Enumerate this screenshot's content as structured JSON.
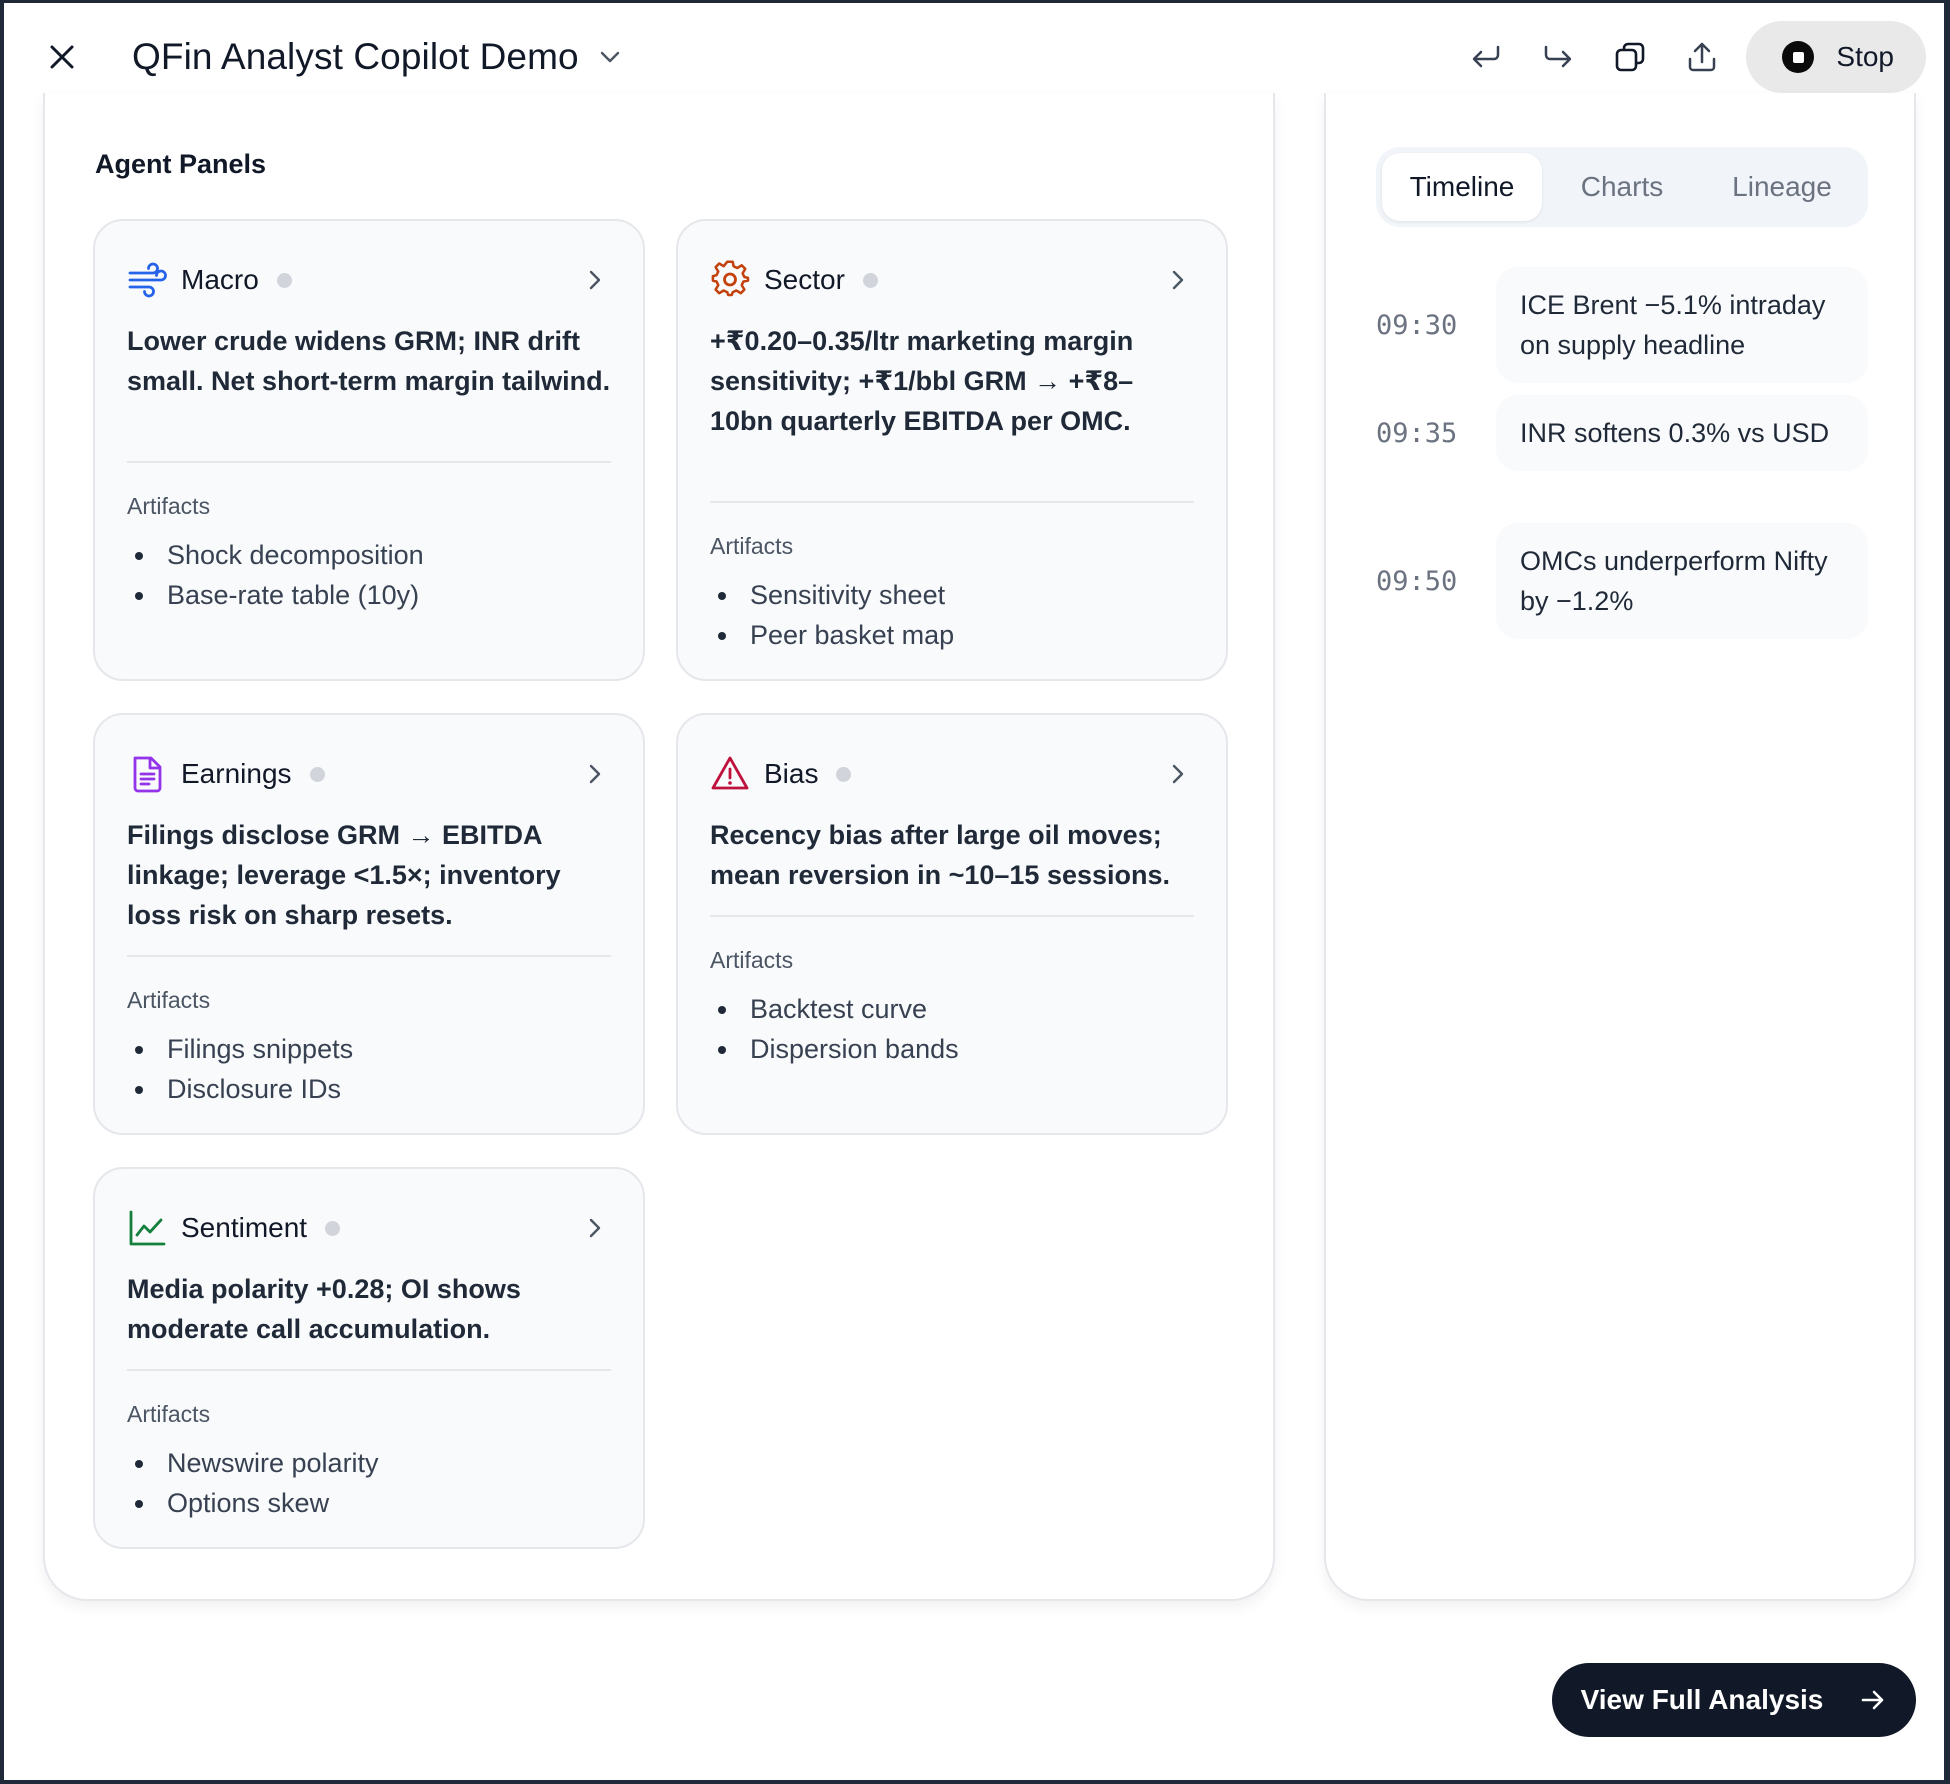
{
  "header": {
    "title": "QFin Analyst Copilot Demo",
    "stop_label": "Stop"
  },
  "agent_panels": {
    "title": "Agent Panels",
    "artifacts_label": "Artifacts",
    "cards": [
      {
        "name": "Macro",
        "icon": "wind-icon",
        "summary": "Lower crude widens GRM; INR drift small. Net short-term margin tailwind.",
        "artifacts": [
          "Shock decomposition",
          "Base-rate table (10y)"
        ]
      },
      {
        "name": "Sector",
        "icon": "gear-icon",
        "summary": "+₹0.20–0.35/ltr marketing margin sensitivity; +₹1/bbl GRM → +₹8–10bn quarterly EBITDA per OMC.",
        "artifacts": [
          "Sensitivity sheet",
          "Peer basket map"
        ]
      },
      {
        "name": "Earnings",
        "icon": "document-icon",
        "summary": "Filings disclose GRM → EBITDA linkage; leverage <1.5×; inventory loss risk on sharp resets.",
        "artifacts": [
          "Filings snippets",
          "Disclosure IDs"
        ]
      },
      {
        "name": "Bias",
        "icon": "warning-icon",
        "summary": "Recency bias after large oil moves; mean reversion in ~10–15 sessions.",
        "artifacts": [
          "Backtest curve",
          "Dispersion bands"
        ]
      },
      {
        "name": "Sentiment",
        "icon": "line-chart-icon",
        "summary": "Media polarity +0.28; OI shows moderate call accumulation.",
        "artifacts": [
          "Newswire polarity",
          "Options skew"
        ]
      }
    ]
  },
  "side": {
    "tabs": [
      "Timeline",
      "Charts",
      "Lineage"
    ],
    "active_tab": "Timeline",
    "timeline": [
      {
        "time": "09:30",
        "text": "ICE Brent −5.1% intraday on supply headline"
      },
      {
        "time": "09:35",
        "text": "INR softens 0.3% vs USD"
      },
      {
        "time": "09:50",
        "text": "OMCs underperform Nifty by −1.2%"
      }
    ]
  },
  "cta": {
    "label": "View Full Analysis"
  },
  "colors": {
    "macro_icon": "#2563eb",
    "sector_icon": "#c2410c",
    "earnings_icon": "#9333ea",
    "bias_icon": "#be123c",
    "sentiment_icon": "#15803d",
    "cta_bg": "#111827"
  }
}
